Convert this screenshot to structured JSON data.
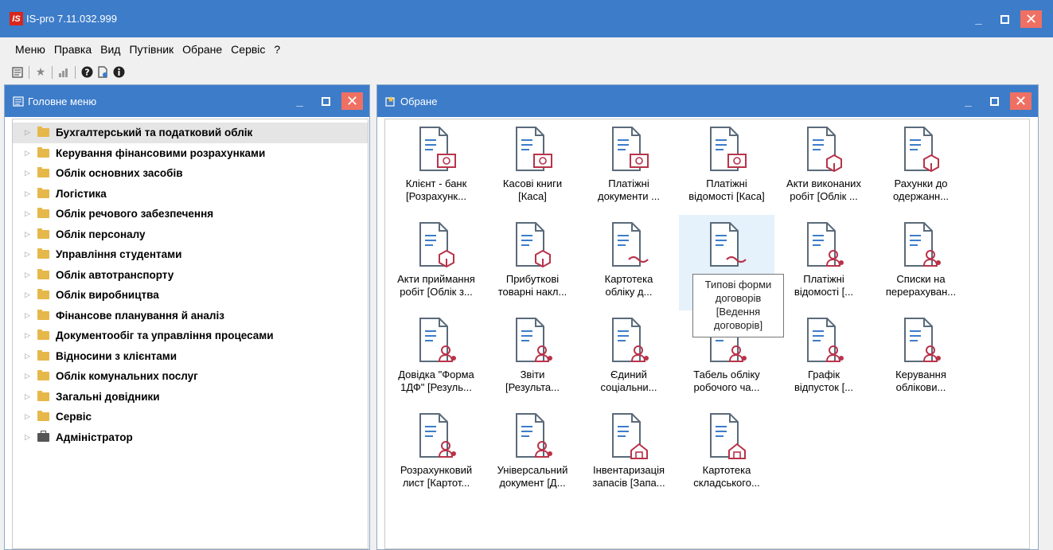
{
  "app": {
    "title": "IS-pro 7.11.032.999",
    "logo_text": "IS"
  },
  "menu": [
    "Меню",
    "Правка",
    "Вид",
    "Путівник",
    "Обране",
    "Сервіс",
    "?"
  ],
  "left_panel": {
    "title": "Головне меню",
    "items": [
      "Бухгалтерський та податковий облік",
      "Керування фінансовими розрахунками",
      "Облік основних засобів",
      "Логістика",
      "Облік речового забезпечення",
      "Облік персоналу",
      "Управління студентами",
      "Облік автотранспорту",
      "Облік виробництва",
      "Фінансове планування й аналіз",
      "Документообіг та управління процесами",
      "Відносини з клієнтами",
      "Облік комунальних послуг",
      "Загальні довідники",
      "Сервіс",
      "Адміністратор"
    ]
  },
  "right_panel": {
    "title": "Обране",
    "tiles": [
      {
        "l1": "Клієнт - банк",
        "l2": "[Розрахунк..."
      },
      {
        "l1": "Касові книги",
        "l2": "[Каса]"
      },
      {
        "l1": "Платіжні",
        "l2": "документи ..."
      },
      {
        "l1": "Платіжні",
        "l2": "відомості [Каса]"
      },
      {
        "l1": "Акти виконаних",
        "l2": "робіт [Облік ..."
      },
      {
        "l1": "Рахунки до",
        "l2": "одержанн..."
      },
      {
        "l1": "Акти приймання",
        "l2": "робіт [Облік з..."
      },
      {
        "l1": "Прибуткові",
        "l2": "товарні накл..."
      },
      {
        "l1": "Картотека",
        "l2": "обліку д..."
      },
      {
        "l1": "",
        "l2": ""
      },
      {
        "l1": "Платіжні",
        "l2": "відомості [..."
      },
      {
        "l1": "Списки на",
        "l2": "перерахуван..."
      },
      {
        "l1": "Довідка \"Форма",
        "l2": "1ДФ\" [Резуль..."
      },
      {
        "l1": "Звіти",
        "l2": "[Результа..."
      },
      {
        "l1": "Єдиний",
        "l2": "соціальни..."
      },
      {
        "l1": "Табель обліку",
        "l2": "робочого ча..."
      },
      {
        "l1": "Графік",
        "l2": "відпусток [..."
      },
      {
        "l1": "Керування",
        "l2": "облікови..."
      },
      {
        "l1": "Розрахунковий",
        "l2": "лист [Картот..."
      },
      {
        "l1": "Універсальний",
        "l2": "документ [Д..."
      },
      {
        "l1": "Інвентаризація",
        "l2": "запасів [Запа..."
      },
      {
        "l1": "Картотека",
        "l2": "складського..."
      }
    ],
    "tooltip": [
      "Типові форми",
      "договорів",
      "[Ведення",
      "договорів]"
    ]
  }
}
